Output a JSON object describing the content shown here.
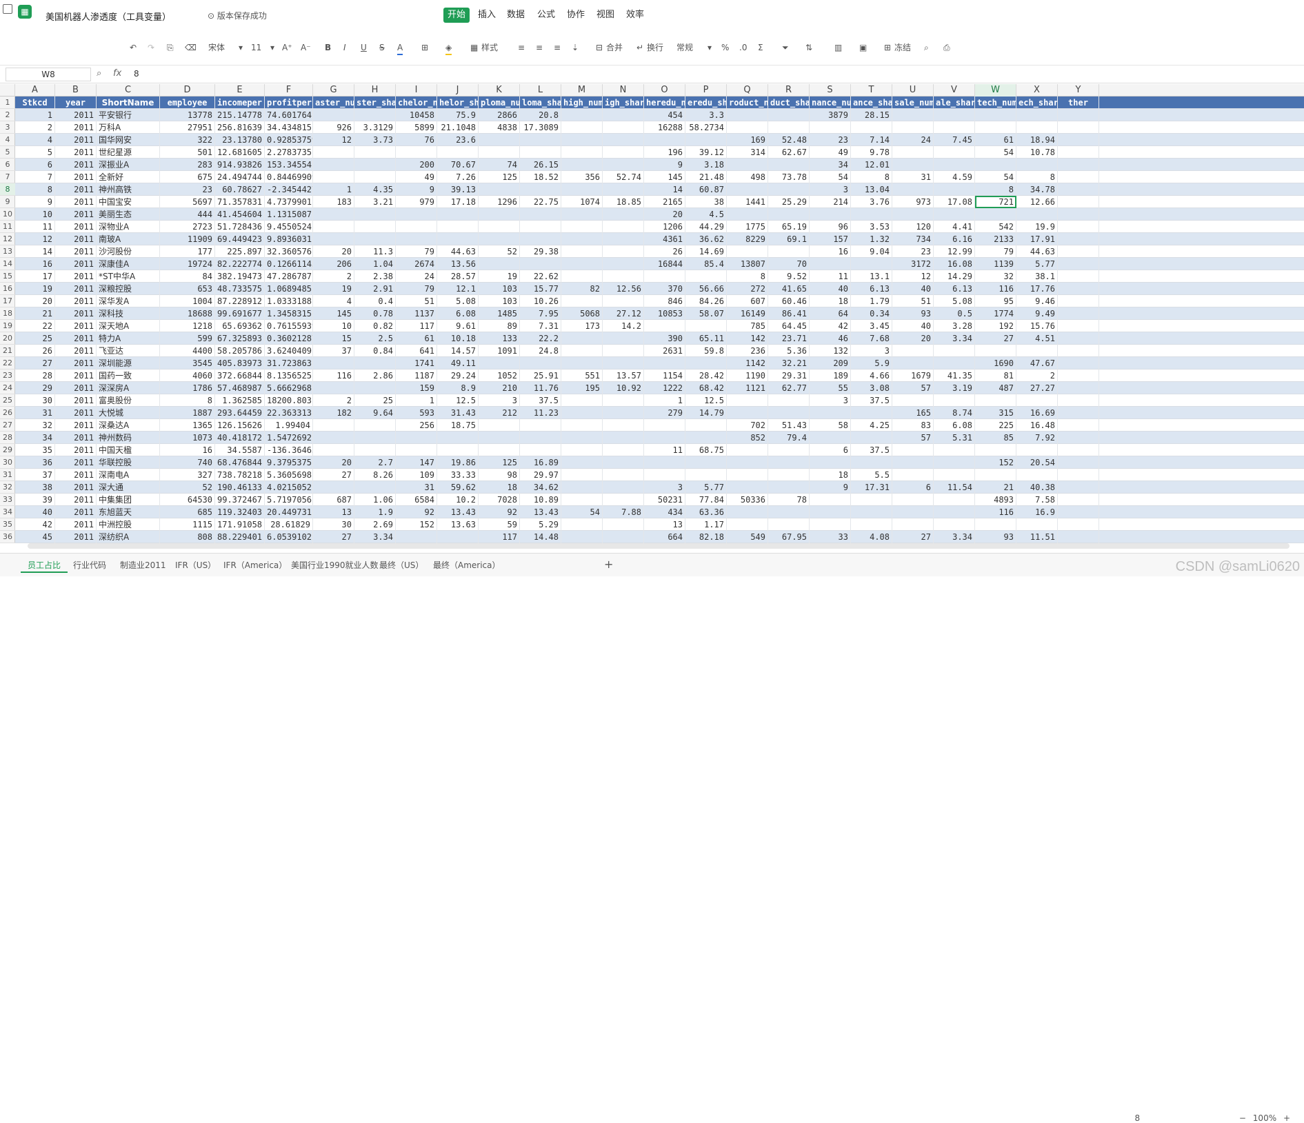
{
  "app": {
    "title": "美国机器人渗透度（工具变量）",
    "saved_status": "版本保存成功",
    "menus": [
      "开始",
      "插入",
      "数据",
      "公式",
      "协作",
      "视图",
      "效率"
    ],
    "active_menu": "开始",
    "accent_color": "#1f9d55"
  },
  "toolbar": {
    "font_name": "宋体",
    "font_size": "11",
    "styles_label": "样式",
    "merge_label": "合并",
    "wrap_label": "换行",
    "number_format": "常规",
    "freeze_label": "冻结",
    "icons": [
      "undo-icon",
      "redo-icon",
      "format-painter-icon",
      "clear-format-icon",
      "bold-icon",
      "italic-icon",
      "underline-icon",
      "strikethrough-icon",
      "font-color-icon",
      "border-icon",
      "fill-color-icon",
      "align-left-icon",
      "align-center-icon",
      "align-right-icon",
      "valign-icon",
      "merge-icon",
      "wrap-icon",
      "percent-icon",
      "decimal-icon",
      "sum-icon",
      "filter-icon",
      "sort-icon",
      "chart-icon",
      "image-icon",
      "freeze-icon",
      "search-icon",
      "print-icon"
    ]
  },
  "formula_bar": {
    "name_box": "W8",
    "value": "8"
  },
  "columns": [
    "A",
    "B",
    "C",
    "D",
    "E",
    "F",
    "G",
    "H",
    "I",
    "J",
    "K",
    "L",
    "M",
    "N",
    "O",
    "P",
    "Q",
    "R",
    "S",
    "T",
    "U",
    "V",
    "W",
    "X",
    "Y"
  ],
  "selected_column": "W",
  "row_numbers": [
    "1",
    "2",
    "3",
    "4",
    "5",
    "6",
    "7",
    "8",
    "9",
    "10",
    "11",
    "12",
    "13",
    "14",
    "15",
    "16",
    "17",
    "18",
    "19",
    "20",
    "21",
    "22",
    "23",
    "24",
    "25",
    "26",
    "27",
    "28",
    "29",
    "30",
    "31",
    "32",
    "33",
    "34",
    "35",
    "36"
  ],
  "selected_row": "8",
  "header_row": [
    "Stkcd",
    "year",
    "ShortName",
    "employee",
    "incomeper",
    "profitper",
    "aster_nu",
    "ster_sha",
    "chelor_n",
    "helor_sh",
    "ploma_nu",
    "loma_sha",
    "high_num",
    "igh_shar",
    "heredu_n",
    "eredu_sh",
    "roduct_n",
    "duct_sha",
    "nance_nu",
    "ance_sha",
    "sale_num",
    "ale_shar",
    "tech_num",
    "ech_shar",
    "ther"
  ],
  "rows": [
    [
      "1",
      "2011",
      "平安银行",
      "13778",
      "215.14778",
      "74.601764",
      "",
      "",
      "10458",
      "75.9",
      "2866",
      "20.8",
      "",
      "",
      "454",
      "3.3",
      "",
      "",
      "3879",
      "28.15",
      "",
      "",
      "",
      "",
      ""
    ],
    [
      "2",
      "2011",
      "万科A",
      "27951",
      "256.81639",
      "34.434815",
      "926",
      "3.3129",
      "5899",
      "21.1048",
      "4838",
      "17.3089",
      "",
      "",
      "16288",
      "58.2734",
      "",
      "",
      "",
      "",
      "",
      "",
      "",
      "",
      ""
    ],
    [
      "4",
      "2011",
      "国华网安",
      "322",
      "23.13780",
      "0.92853759",
      "12",
      "3.73",
      "76",
      "23.6",
      "",
      "",
      "",
      "",
      "",
      "",
      "169",
      "52.48",
      "23",
      "7.14",
      "24",
      "7.45",
      "61",
      "18.94",
      ""
    ],
    [
      "5",
      "2011",
      "世纪星源",
      "501",
      "12.681605",
      "2.2783735",
      "",
      "",
      "",
      "",
      "",
      "",
      "",
      "",
      "196",
      "39.12",
      "314",
      "62.67",
      "49",
      "9.78",
      "",
      "",
      "54",
      "10.78",
      ""
    ],
    [
      "6",
      "2011",
      "深振业A",
      "283",
      "914.93826",
      "153.34554",
      "",
      "",
      "200",
      "70.67",
      "74",
      "26.15",
      "",
      "",
      "9",
      "3.18",
      "",
      "",
      "34",
      "12.01",
      "",
      "",
      "",
      "",
      ""
    ],
    [
      "7",
      "2011",
      "全新好",
      "675",
      "24.494744",
      "0.84469909",
      "",
      "",
      "49",
      "7.26",
      "125",
      "18.52",
      "356",
      "52.74",
      "145",
      "21.48",
      "498",
      "73.78",
      "54",
      "8",
      "31",
      "4.59",
      "54",
      "8",
      ""
    ],
    [
      "8",
      "2011",
      "神州高铁",
      "23",
      "60.78627",
      "-2.3454427",
      "1",
      "4.35",
      "9",
      "39.13",
      "",
      "",
      "",
      "",
      "14",
      "60.87",
      "",
      "",
      "3",
      "13.04",
      "",
      "",
      "8",
      "34.78",
      ""
    ],
    [
      "9",
      "2011",
      "中国宝安",
      "5697",
      "71.357831",
      "4.7379901",
      "183",
      "3.21",
      "979",
      "17.18",
      "1296",
      "22.75",
      "1074",
      "18.85",
      "2165",
      "38",
      "1441",
      "25.29",
      "214",
      "3.76",
      "973",
      "17.08",
      "721",
      "12.66",
      ""
    ],
    [
      "10",
      "2011",
      "美丽生态",
      "444",
      "41.454604",
      "1.1315087",
      "",
      "",
      "",
      "",
      "",
      "",
      "",
      "",
      "20",
      "4.5",
      "",
      "",
      "",
      "",
      "",
      "",
      "",
      "",
      ""
    ],
    [
      "11",
      "2011",
      "深物业A",
      "2723",
      "51.728436",
      "9.4550524",
      "",
      "",
      "",
      "",
      "",
      "",
      "",
      "",
      "1206",
      "44.29",
      "1775",
      "65.19",
      "96",
      "3.53",
      "120",
      "4.41",
      "542",
      "19.9",
      ""
    ],
    [
      "12",
      "2011",
      "南玻A",
      "11909",
      "69.449423",
      "9.8936031",
      "",
      "",
      "",
      "",
      "",
      "",
      "",
      "",
      "4361",
      "36.62",
      "8229",
      "69.1",
      "157",
      "1.32",
      "734",
      "6.16",
      "2133",
      "17.91",
      ""
    ],
    [
      "14",
      "2011",
      "沙河股份",
      "177",
      "225.897",
      "32.360576",
      "20",
      "11.3",
      "79",
      "44.63",
      "52",
      "29.38",
      "",
      "",
      "26",
      "14.69",
      "",
      "",
      "16",
      "9.04",
      "23",
      "12.99",
      "79",
      "44.63",
      ""
    ],
    [
      "16",
      "2011",
      "深康佳A",
      "19724",
      "82.222774",
      "0.12661143",
      "206",
      "1.04",
      "2674",
      "13.56",
      "",
      "",
      "",
      "",
      "16844",
      "85.4",
      "13807",
      "70",
      "",
      "",
      "3172",
      "16.08",
      "1139",
      "5.77",
      ""
    ],
    [
      "17",
      "2011",
      "*ST中华A",
      "84",
      "382.19473",
      "47.286787",
      "2",
      "2.38",
      "24",
      "28.57",
      "19",
      "22.62",
      "",
      "",
      "",
      "",
      "8",
      "9.52",
      "11",
      "13.1",
      "12",
      "14.29",
      "32",
      "38.1",
      ""
    ],
    [
      "19",
      "2011",
      "深粮控股",
      "653",
      "48.733575",
      "1.0689485",
      "19",
      "2.91",
      "79",
      "12.1",
      "103",
      "15.77",
      "82",
      "12.56",
      "370",
      "56.66",
      "272",
      "41.65",
      "40",
      "6.13",
      "40",
      "6.13",
      "116",
      "17.76",
      ""
    ],
    [
      "20",
      "2011",
      "深华发A",
      "1004",
      "87.228912",
      "1.0333188",
      "4",
      "0.4",
      "51",
      "5.08",
      "103",
      "10.26",
      "",
      "",
      "846",
      "84.26",
      "607",
      "60.46",
      "18",
      "1.79",
      "51",
      "5.08",
      "95",
      "9.46",
      ""
    ],
    [
      "21",
      "2011",
      "深科技",
      "18688",
      "99.691677",
      "1.3458315",
      "145",
      "0.78",
      "1137",
      "6.08",
      "1485",
      "7.95",
      "5068",
      "27.12",
      "10853",
      "58.07",
      "16149",
      "86.41",
      "64",
      "0.34",
      "93",
      "0.5",
      "1774",
      "9.49",
      ""
    ],
    [
      "22",
      "2011",
      "深天地A",
      "1218",
      "65.69362",
      "0.76155939",
      "10",
      "0.82",
      "117",
      "9.61",
      "89",
      "7.31",
      "173",
      "14.2",
      "",
      "",
      "785",
      "64.45",
      "42",
      "3.45",
      "40",
      "3.28",
      "192",
      "15.76",
      ""
    ],
    [
      "25",
      "2011",
      "特力A",
      "599",
      "67.325893",
      "0.36021287",
      "15",
      "2.5",
      "61",
      "10.18",
      "133",
      "22.2",
      "",
      "",
      "390",
      "65.11",
      "142",
      "23.71",
      "46",
      "7.68",
      "20",
      "3.34",
      "27",
      "4.51",
      ""
    ],
    [
      "26",
      "2011",
      "飞亚达",
      "4400",
      "58.205786",
      "3.6240409",
      "37",
      "0.84",
      "641",
      "14.57",
      "1091",
      "24.8",
      "",
      "",
      "2631",
      "59.8",
      "236",
      "5.36",
      "132",
      "3",
      "",
      "",
      "",
      "",
      ""
    ],
    [
      "27",
      "2011",
      "深圳能源",
      "3545",
      "405.83973",
      "31.723863",
      "",
      "",
      "1741",
      "49.11",
      "",
      "",
      "",
      "",
      "",
      "",
      "1142",
      "32.21",
      "209",
      "5.9",
      "",
      "",
      "1690",
      "47.67",
      ""
    ],
    [
      "28",
      "2011",
      "国药一致",
      "4060",
      "372.66844",
      "8.1356525",
      "116",
      "2.86",
      "1187",
      "29.24",
      "1052",
      "25.91",
      "551",
      "13.57",
      "1154",
      "28.42",
      "1190",
      "29.31",
      "189",
      "4.66",
      "1679",
      "41.35",
      "81",
      "2",
      ""
    ],
    [
      "29",
      "2011",
      "深深房A",
      "1786",
      "57.468987",
      "5.6662968",
      "",
      "",
      "159",
      "8.9",
      "210",
      "11.76",
      "195",
      "10.92",
      "1222",
      "68.42",
      "1121",
      "62.77",
      "55",
      "3.08",
      "57",
      "3.19",
      "487",
      "27.27",
      ""
    ],
    [
      "30",
      "2011",
      "富奥股份",
      "8",
      "1.362585",
      "18200.803",
      "2",
      "25",
      "1",
      "12.5",
      "3",
      "37.5",
      "",
      "",
      "1",
      "12.5",
      "",
      "",
      "3",
      "37.5",
      "",
      "",
      "",
      "",
      ""
    ],
    [
      "31",
      "2011",
      "大悦城",
      "1887",
      "293.64459",
      "22.363313",
      "182",
      "9.64",
      "593",
      "31.43",
      "212",
      "11.23",
      "",
      "",
      "279",
      "14.79",
      "",
      "",
      "",
      "",
      "165",
      "8.74",
      "315",
      "16.69",
      ""
    ],
    [
      "32",
      "2011",
      "深桑达A",
      "1365",
      "126.15626",
      "1.99404",
      "",
      "",
      "256",
      "18.75",
      "",
      "",
      "",
      "",
      "",
      "",
      "702",
      "51.43",
      "58",
      "4.25",
      "83",
      "6.08",
      "225",
      "16.48",
      ""
    ],
    [
      "34",
      "2011",
      "神州数码",
      "1073",
      "40.418172",
      "1.5472692",
      "",
      "",
      "",
      "",
      "",
      "",
      "",
      "",
      "",
      "",
      "852",
      "79.4",
      "",
      "",
      "57",
      "5.31",
      "85",
      "7.92",
      ""
    ],
    [
      "35",
      "2011",
      "中国天楹",
      "16",
      "34.5587",
      "-136.36463",
      "",
      "",
      "",
      "",
      "",
      "",
      "",
      "",
      "11",
      "68.75",
      "",
      "",
      "6",
      "37.5",
      "",
      "",
      "",
      "",
      ""
    ],
    [
      "36",
      "2011",
      "华联控股",
      "740",
      "68.476844",
      "9.3795375",
      "20",
      "2.7",
      "147",
      "19.86",
      "125",
      "16.89",
      "",
      "",
      "",
      "",
      "",
      "",
      "",
      "",
      "",
      "",
      "152",
      "20.54",
      ""
    ],
    [
      "37",
      "2011",
      "深南电A",
      "327",
      "738.78218",
      "5.3605698",
      "27",
      "8.26",
      "109",
      "33.33",
      "98",
      "29.97",
      "",
      "",
      "",
      "",
      "",
      "",
      "18",
      "5.5",
      "",
      "",
      "",
      "",
      ""
    ],
    [
      "38",
      "2011",
      "深大通",
      "52",
      "190.46133",
      "4.0215052",
      "",
      "",
      "31",
      "59.62",
      "18",
      "34.62",
      "",
      "",
      "3",
      "5.77",
      "",
      "",
      "9",
      "17.31",
      "6",
      "11.54",
      "21",
      "40.38",
      ""
    ],
    [
      "39",
      "2011",
      "中集集团",
      "64530",
      "99.372467",
      "5.7197056",
      "687",
      "1.06",
      "6584",
      "10.2",
      "7028",
      "10.89",
      "",
      "",
      "50231",
      "77.84",
      "50336",
      "78",
      "",
      "",
      "",
      "",
      "4893",
      "7.58",
      ""
    ],
    [
      "40",
      "2011",
      "东旭蓝天",
      "685",
      "119.32403",
      "20.449731",
      "13",
      "1.9",
      "92",
      "13.43",
      "92",
      "13.43",
      "54",
      "7.88",
      "434",
      "63.36",
      "",
      "",
      "",
      "",
      "",
      "",
      "116",
      "16.9",
      ""
    ],
    [
      "42",
      "2011",
      "中洲控股",
      "1115",
      "171.91058",
      "28.61829",
      "30",
      "2.69",
      "152",
      "13.63",
      "59",
      "5.29",
      "",
      "",
      "13",
      "1.17",
      "",
      "",
      "",
      "",
      "",
      "",
      "",
      "",
      ""
    ],
    [
      "45",
      "2011",
      "深纺织A",
      "808",
      "88.229401",
      "6.0539102",
      "27",
      "3.34",
      "",
      "",
      "117",
      "14.48",
      "",
      "",
      "664",
      "82.18",
      "549",
      "67.95",
      "33",
      "4.08",
      "27",
      "3.34",
      "93",
      "11.51",
      ""
    ]
  ],
  "active_cell": {
    "row": 7,
    "col": 22
  },
  "sheet_tabs": [
    "员工占比",
    "行业代码",
    "制造业2011",
    "IFR（US）",
    "IFR（America）",
    "美国行业1990就业人数",
    "最终（US）",
    "最终（America）"
  ],
  "active_tab": "员工占比",
  "status": {
    "value": "8",
    "zoom": "100%"
  },
  "watermark": "CSDN @samLi0620"
}
